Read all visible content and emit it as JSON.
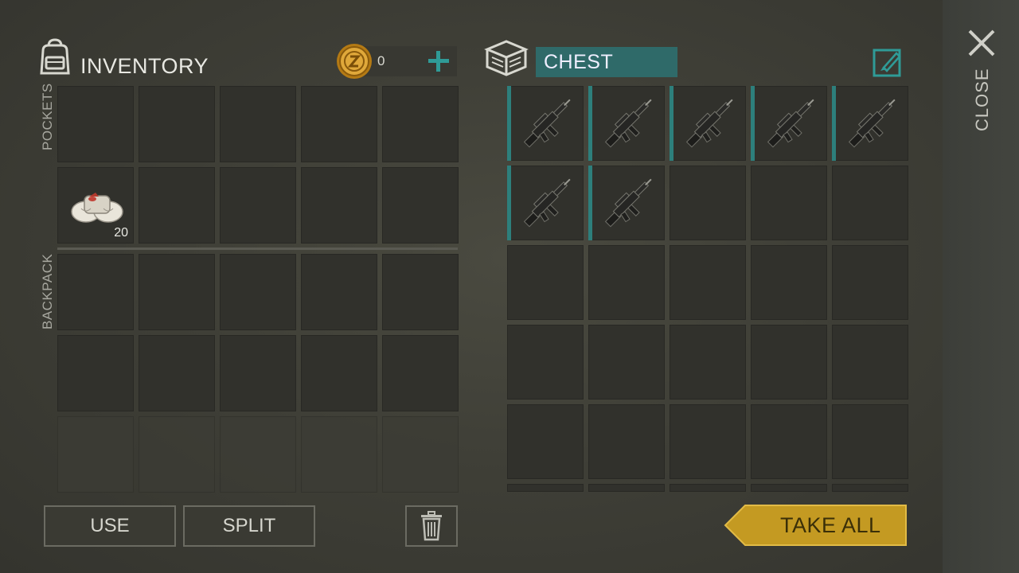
{
  "inventory": {
    "title": "INVENTORY",
    "coins": "0",
    "pockets_label": "POCKETS",
    "backpack_label": "BACKPACK",
    "bandage_quantity": "20"
  },
  "chest": {
    "name": "CHEST",
    "rifle_count": 7
  },
  "close_label": "CLOSE",
  "buttons": {
    "use": "USE",
    "split": "SPLIT",
    "take_all": "TAKE ALL"
  },
  "colors": {
    "accent_teal": "#2f8f8c",
    "take_all_gold": "#c49a22"
  },
  "icons": {
    "inventory": "backpack-icon",
    "coin": "coin-icon",
    "add": "plus-icon",
    "chest": "chest-icon",
    "edit": "edit-pencil-icon",
    "close": "close-x-icon",
    "trash": "trash-icon",
    "bandage": "bandage-icon",
    "rifle": "assault-rifle-icon"
  }
}
